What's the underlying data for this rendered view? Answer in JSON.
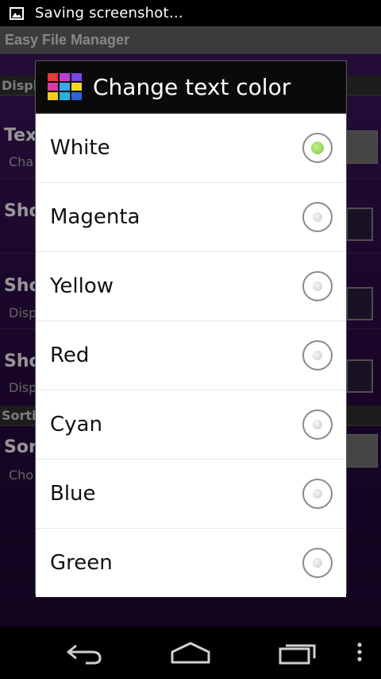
{
  "status_bar": {
    "notification_text": "Saving screenshot…",
    "icon": "image-icon"
  },
  "app": {
    "title": "Easy File Manager",
    "section_display": "Displ",
    "section_sorting": "Sorti",
    "prefs": [
      {
        "title": "Tex",
        "summary": "Cha"
      },
      {
        "title": "Sho",
        "summary": ""
      },
      {
        "title": "Sho",
        "summary": "Disp"
      },
      {
        "title": "Sho",
        "summary": "Disp"
      },
      {
        "title": "Sort",
        "summary": "Cho"
      }
    ]
  },
  "dialog": {
    "title": "Change text color",
    "icon": "color-palette-icon",
    "selected": "White",
    "options": [
      {
        "label": "White",
        "checked": true
      },
      {
        "label": "Magenta",
        "checked": false
      },
      {
        "label": "Yellow",
        "checked": false
      },
      {
        "label": "Red",
        "checked": false
      },
      {
        "label": "Cyan",
        "checked": false
      },
      {
        "label": "Blue",
        "checked": false
      },
      {
        "label": "Green",
        "checked": false
      }
    ]
  },
  "navbar": {
    "icons": [
      "back-icon",
      "home-icon",
      "recent-apps-icon",
      "menu-icon"
    ]
  },
  "colors": {
    "accent_selected": "#7ac83a",
    "dialog_header": "#0a0a0a",
    "app_background": "#3a1458"
  }
}
